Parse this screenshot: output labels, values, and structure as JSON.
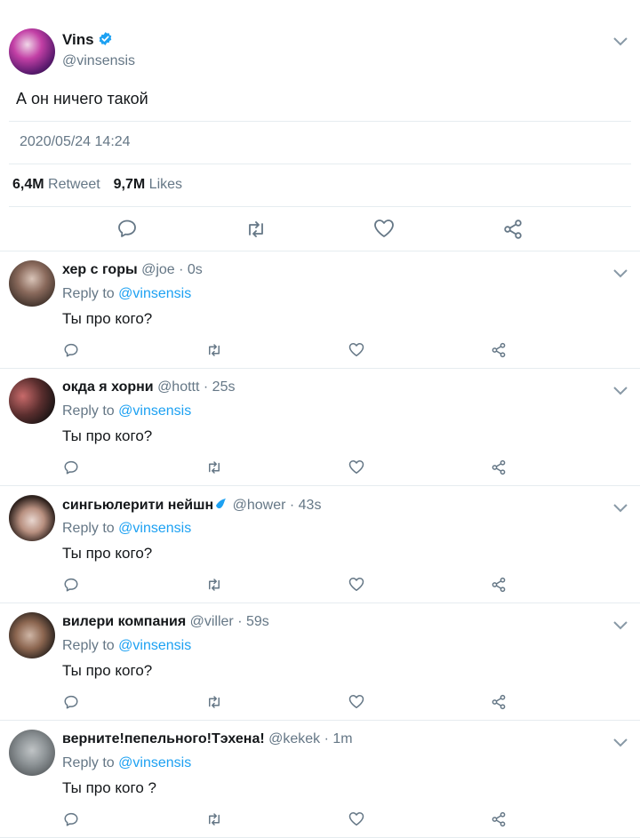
{
  "tweet": {
    "author_name": "Vins",
    "handle": "@vinsensis",
    "text": "А он ничего такой",
    "timestamp": "2020/05/24 14:24",
    "retweets_count": "6,4M",
    "retweets_label": "Retweet",
    "likes_count": "9,7M",
    "likes_label": "Likes"
  },
  "replies": [
    {
      "name": "хер с горы",
      "handle": "@joe",
      "time": "· 0s",
      "reply_to_label": "Reply to",
      "reply_to_handle": "@vinsensis",
      "text": "Ты про кого?"
    },
    {
      "name": "окда я хорни",
      "handle": "@hottt",
      "time": "· 25s",
      "reply_to_label": "Reply to",
      "reply_to_handle": "@vinsensis",
      "text": "Ты про кого?"
    },
    {
      "name": "сингьюлерити нейшн",
      "handle": "@hower",
      "time": "· 43s",
      "reply_to_label": "Reply to",
      "reply_to_handle": "@vinsensis",
      "text": "Ты про кого?"
    },
    {
      "name": "вилери компания",
      "handle": "@viller",
      "time": "· 59s",
      "reply_to_label": "Reply to",
      "reply_to_handle": "@vinsensis",
      "text": "Ты про кого?"
    },
    {
      "name": "верните!пепельного!Тэхена!",
      "handle": "@kekek",
      "time": "· 1m",
      "reply_to_label": "Reply to",
      "reply_to_handle": "@vinsensis",
      "text": "Ты про кого ?"
    }
  ],
  "icons": {
    "reply": "reply-icon",
    "retweet": "retweet-icon",
    "like": "heart-icon",
    "share": "share-icon",
    "menu": "chevron-down-icon",
    "verified": "verified-badge-icon"
  },
  "colors": {
    "accent": "#1da1f2",
    "secondary_text": "#657786",
    "divider": "#e6ecf0"
  }
}
